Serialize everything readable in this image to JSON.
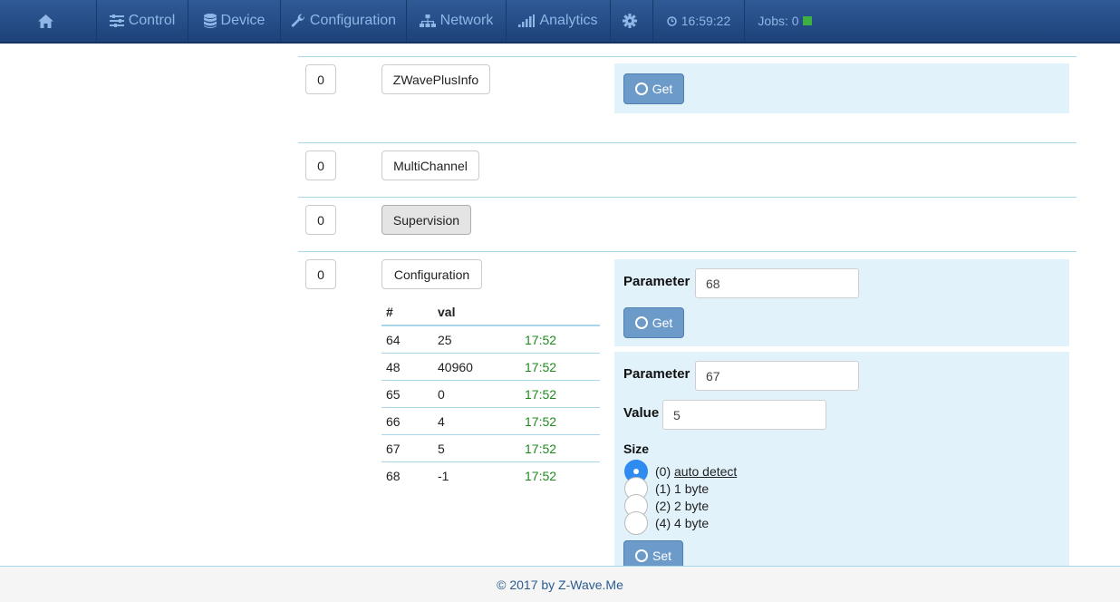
{
  "nav": {
    "control": "Control",
    "device": "Device",
    "configuration": "Configuration",
    "network": "Network",
    "analytics": "Analytics",
    "time": "16:59:22",
    "jobs": "Jobs: 0"
  },
  "rows": [
    {
      "count": "0",
      "name": "ZWavePlusInfo",
      "get_label": "Get"
    },
    {
      "count": "0",
      "name": "MultiChannel"
    },
    {
      "count": "0",
      "name": "Supervision"
    },
    {
      "count": "0",
      "name": "Configuration"
    }
  ],
  "config": {
    "table_headers": [
      "#",
      "val",
      ""
    ],
    "table_rows": [
      {
        "num": "64",
        "val": "25",
        "time": "17:52"
      },
      {
        "num": "48",
        "val": "40960",
        "time": "17:52"
      },
      {
        "num": "65",
        "val": "0",
        "time": "17:52"
      },
      {
        "num": "66",
        "val": "4",
        "time": "17:52"
      },
      {
        "num": "67",
        "val": "5",
        "time": "17:52"
      },
      {
        "num": "68",
        "val": "-1",
        "time": "17:52"
      }
    ],
    "get_panel": {
      "param_label": "Parameter",
      "param_value": "68",
      "get_label": "Get"
    },
    "set_panel": {
      "param_label": "Parameter",
      "param_value": "67",
      "value_label": "Value",
      "value_value": "5",
      "size_label": "Size",
      "size_options": [
        {
          "prefix": "(0)",
          "label": "auto detect",
          "selected": true
        },
        {
          "prefix": "(1)",
          "label": "1 byte",
          "selected": false
        },
        {
          "prefix": "(2)",
          "label": "2 byte",
          "selected": false
        },
        {
          "prefix": "(4)",
          "label": "4 byte",
          "selected": false
        }
      ],
      "set_label": "Set"
    }
  },
  "footer": "© 2017 by Z-Wave.Me",
  "colors": {
    "nav_bg": "#2f5a96",
    "nav_text": "#8fb6e6",
    "panel_bg": "#e1f2fb",
    "button_blue": "#6d9bc9",
    "time_green": "#1e8a1e"
  }
}
